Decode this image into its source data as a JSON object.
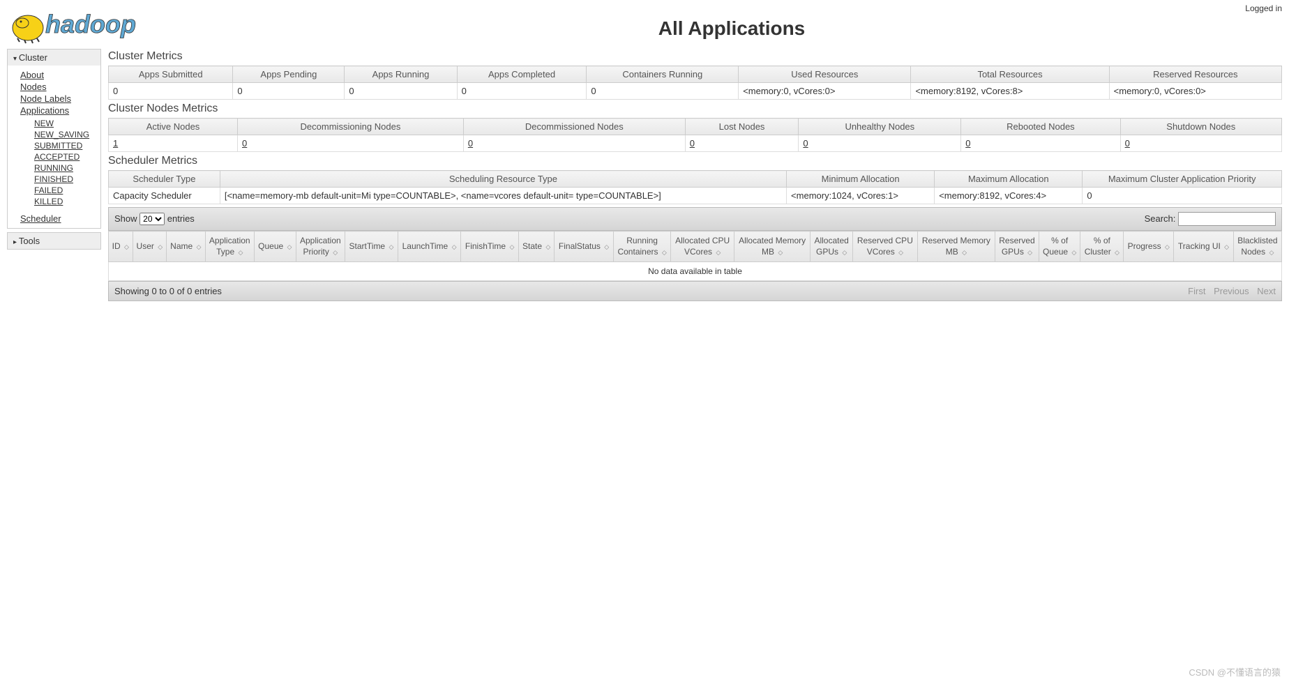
{
  "header": {
    "title": "All Applications",
    "logged_in": "Logged in"
  },
  "sidebar": {
    "cluster_label": "Cluster",
    "tools_label": "Tools",
    "links": {
      "about": "About",
      "nodes": "Nodes",
      "node_labels": "Node Labels",
      "applications": "Applications",
      "scheduler": "Scheduler"
    },
    "app_states": [
      "NEW",
      "NEW_SAVING",
      "SUBMITTED",
      "ACCEPTED",
      "RUNNING",
      "FINISHED",
      "FAILED",
      "KILLED"
    ]
  },
  "sections": {
    "cluster_metrics": "Cluster Metrics",
    "cluster_nodes": "Cluster Nodes Metrics",
    "scheduler_metrics": "Scheduler Metrics"
  },
  "cluster_metrics": {
    "headers": [
      "Apps Submitted",
      "Apps Pending",
      "Apps Running",
      "Apps Completed",
      "Containers Running",
      "Used Resources",
      "Total Resources",
      "Reserved Resources"
    ],
    "row": [
      "0",
      "0",
      "0",
      "0",
      "0",
      "<memory:0, vCores:0>",
      "<memory:8192, vCores:8>",
      "<memory:0, vCores:0>"
    ]
  },
  "nodes_metrics": {
    "headers": [
      "Active Nodes",
      "Decommissioning Nodes",
      "Decommissioned Nodes",
      "Lost Nodes",
      "Unhealthy Nodes",
      "Rebooted Nodes",
      "Shutdown Nodes"
    ],
    "row": [
      "1",
      "0",
      "0",
      "0",
      "0",
      "0",
      "0"
    ]
  },
  "scheduler_metrics": {
    "headers": [
      "Scheduler Type",
      "Scheduling Resource Type",
      "Minimum Allocation",
      "Maximum Allocation",
      "Maximum Cluster Application Priority"
    ],
    "row": [
      "Capacity Scheduler",
      "[<name=memory-mb default-unit=Mi type=COUNTABLE>, <name=vcores default-unit= type=COUNTABLE>]",
      "<memory:1024, vCores:1>",
      "<memory:8192, vCores:4>",
      "0"
    ]
  },
  "datatable": {
    "show_label": "Show",
    "entries_label": "entries",
    "length_value": "20",
    "search_label": "Search:",
    "columns": [
      "ID",
      "User",
      "Name",
      "Application Type",
      "Queue",
      "Application Priority",
      "StartTime",
      "LaunchTime",
      "FinishTime",
      "State",
      "FinalStatus",
      "Running Containers",
      "Allocated CPU VCores",
      "Allocated Memory MB",
      "Allocated GPUs",
      "Reserved CPU VCores",
      "Reserved Memory MB",
      "Reserved GPUs",
      "% of Queue",
      "% of Cluster",
      "Progress",
      "Tracking UI",
      "Blacklisted Nodes"
    ],
    "empty": "No data available in table",
    "info": "Showing 0 to 0 of 0 entries",
    "pager": {
      "first": "First",
      "prev": "Previous",
      "next": "Next"
    }
  },
  "watermark": "CSDN @不懂语言的猿"
}
